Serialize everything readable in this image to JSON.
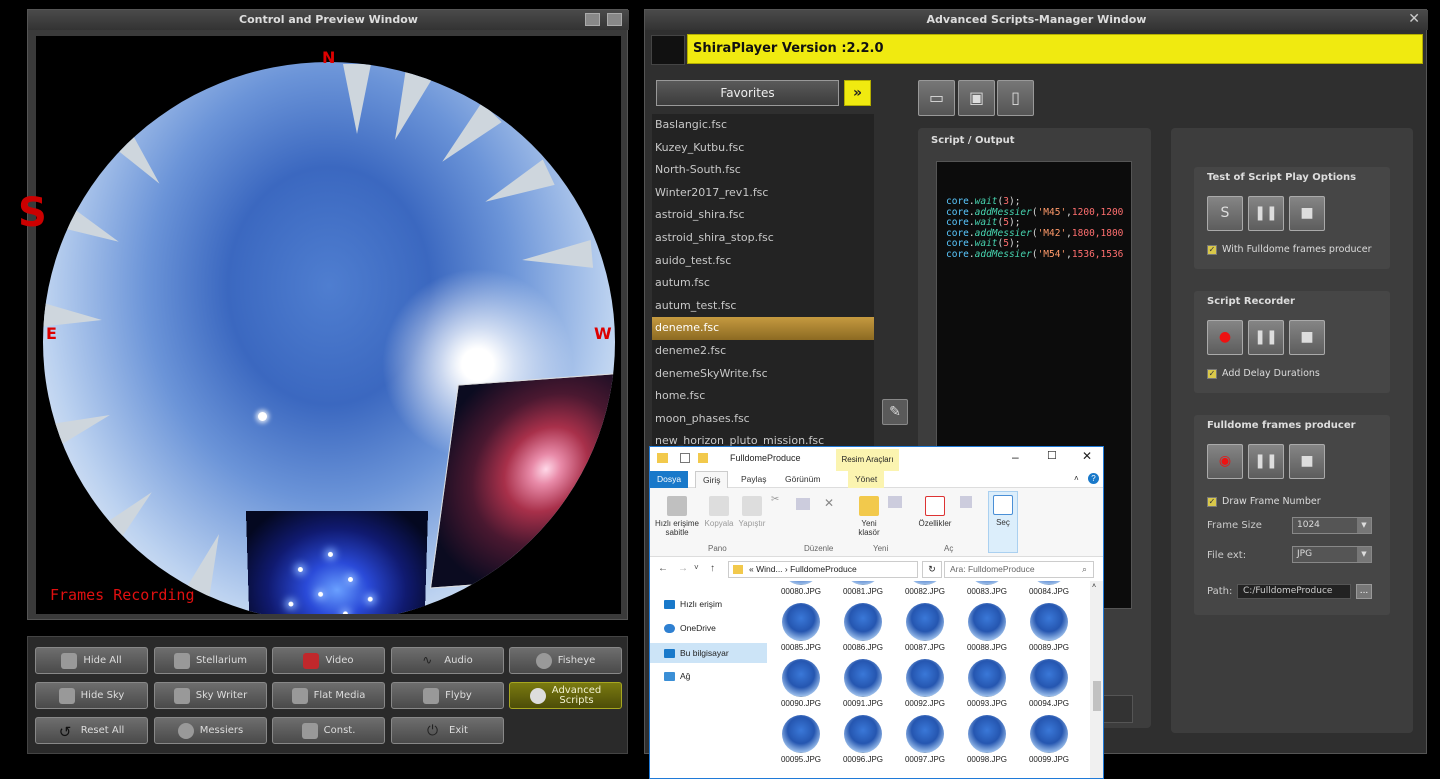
{
  "left_window": {
    "title": "Control and Preview Window",
    "cardinal_n": "N",
    "cardinal_e": "E",
    "cardinal_w": "W",
    "overlay_text": "Frames Recording",
    "side_letter": "S"
  },
  "toolbar": {
    "buttons": [
      {
        "label": "Hide All",
        "icon": "square-icon"
      },
      {
        "label": "Stellarium",
        "icon": "robot-icon"
      },
      {
        "label": "Video",
        "icon": "video-icon"
      },
      {
        "label": "Audio",
        "icon": "audio-wave-icon"
      },
      {
        "label": "Fisheye",
        "icon": "globe-icon"
      },
      {
        "label": "Hide Sky",
        "icon": "hide-sky-icon"
      },
      {
        "label": "Sky Writer",
        "icon": "pen-icon"
      },
      {
        "label": "Flat Media",
        "icon": "camera-icon"
      },
      {
        "label": "Flyby",
        "icon": "rocket-icon"
      },
      {
        "label": "Advanced Scripts",
        "line1": "Advanced",
        "line2": "Scripts",
        "icon": "s-logo-icon"
      },
      {
        "label": "Reset All",
        "icon": "reset-icon"
      },
      {
        "label": "Messiers",
        "icon": "galaxy-icon"
      },
      {
        "label": "Const.",
        "icon": "constellation-icon"
      },
      {
        "label": "Exit",
        "icon": "power-icon"
      }
    ]
  },
  "right_window": {
    "title": "Advanced Scripts-Manager Window",
    "close": "✕",
    "version": "ShiraPlayer Version :2.2.0",
    "favorites_label": "Favorites",
    "files": [
      "Baslangic.fsc",
      "Kuzey_Kutbu.fsc",
      "North-South.fsc",
      "Winter2017_rev1.fsc",
      "astroid_shira.fsc",
      "astroid_shira_stop.fsc",
      "auido_test.fsc",
      "autum.fsc",
      "autum_test.fsc",
      "deneme.fsc",
      "deneme2.fsc",
      "denemeSkyWrite.fsc",
      "home.fsc",
      "moon_phases.fsc",
      "new_horizon_pluto_mission.fsc"
    ],
    "selected_file": "deneme.fsc",
    "script_label": "Script / Output",
    "code_lines": [
      {
        "obj": "core",
        "fn": "wait",
        "args": "3",
        "type": "num"
      },
      {
        "obj": "core",
        "fn": "addMessier",
        "str": "'M45'",
        "args": "1200,1200",
        "type": "mix"
      },
      {
        "obj": "core",
        "fn": "wait",
        "args": "5",
        "type": "num"
      },
      {
        "obj": "core",
        "fn": "addMessier",
        "str": "'M42'",
        "args": "1800,1800",
        "type": "mix"
      },
      {
        "obj": "core",
        "fn": "wait",
        "args": "5",
        "type": "num"
      },
      {
        "obj": "core",
        "fn": "addMessier",
        "str": "'M54'",
        "args": "1536,1536",
        "type": "mix"
      }
    ],
    "test_options": {
      "title": "Test of Script Play Options",
      "checkbox": "With Fulldome frames producer"
    },
    "recorder": {
      "title": "Script Recorder",
      "checkbox": "Add Delay Durations"
    },
    "producer": {
      "title": "Fulldome frames producer",
      "checkbox": "Draw Frame Number",
      "frame_size_label": "Frame Size",
      "frame_size_value": "1024",
      "file_ext_label": "File ext:",
      "file_ext_value": "JPG",
      "path_label": "Path:",
      "path_value": "C:/FulldomeProduce",
      "path_button": "..."
    }
  },
  "explorer": {
    "title": "FulldomeProduce",
    "context_tab": "Resim Araçları",
    "tabs": [
      "Dosya",
      "Giriş",
      "Paylaş",
      "Görünüm",
      "Yönet"
    ],
    "ribbon": {
      "pin": "Hızlı erişime sabitle",
      "copy": "Kopyala",
      "paste": "Yapıştır",
      "new_folder": "Yeni klasör",
      "properties": "Özellikler",
      "select": "Seç",
      "groups": [
        "Pano",
        "Düzenle",
        "Yeni",
        "Aç"
      ]
    },
    "breadcrumb": [
      "Wind...",
      "FulldomeProduce"
    ],
    "search_placeholder": "Ara: FulldomeProduce",
    "nav": [
      "Hızlı erişim",
      "OneDrive",
      "Bu bilgisayar",
      "Ağ"
    ],
    "files": [
      "00080.JPG",
      "00081.JPG",
      "00082.JPG",
      "00083.JPG",
      "00084.JPG",
      "00085.JPG",
      "00086.JPG",
      "00087.JPG",
      "00088.JPG",
      "00089.JPG",
      "00090.JPG",
      "00091.JPG",
      "00092.JPG",
      "00093.JPG",
      "00094.JPG",
      "00095.JPG",
      "00096.JPG",
      "00097.JPG",
      "00098.JPG",
      "00099.JPG"
    ]
  }
}
